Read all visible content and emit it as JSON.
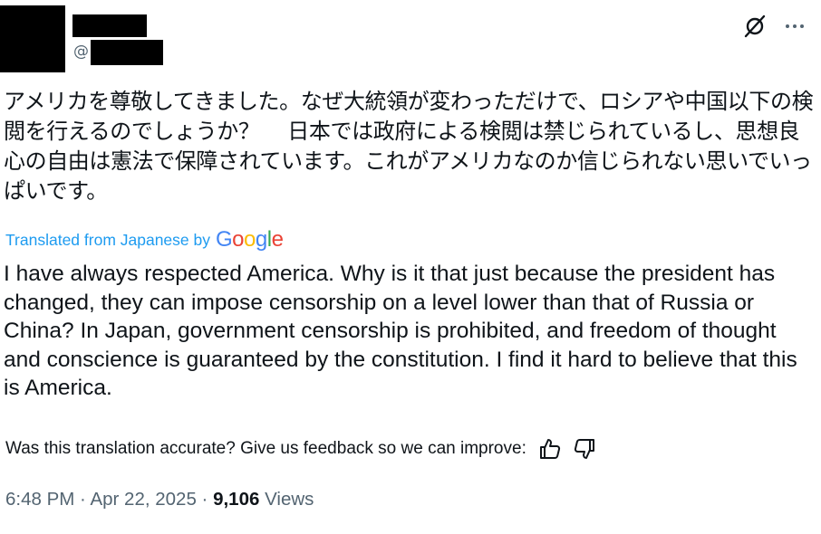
{
  "header": {
    "handle_prefix": "@",
    "icons": {
      "grok": "grok-icon",
      "more": "more-icon"
    }
  },
  "tweet": {
    "original_text": "アメリカを尊敬してきました。なぜ大統領が変わっただけで、ロシアや中国以下の検閲を行えるのでしょうか？　 日本では政府による検閲は禁じられているし、思想良心の自由は憲法で保障されています。これがアメリカなのか信じられない思いでいっぱいです。",
    "translated_label": "Translated from Japanese by",
    "translator_brand": {
      "g1": "G",
      "o1": "o",
      "o2": "o",
      "g2": "g",
      "l": "l",
      "e": "e"
    },
    "translated_text": "I have always respected America. Why is it that just because the president has changed, they can impose censorship on a level lower than that of Russia or China? In Japan, government censorship is prohibited, and freedom of thought and conscience is guaranteed by the constitution. I find it hard to believe that this is America."
  },
  "feedback": {
    "prompt": "Was this translation accurate? Give us feedback so we can improve:",
    "icons": {
      "up": "thumbs-up-icon",
      "down": "thumbs-down-icon"
    }
  },
  "meta": {
    "time": "6:48 PM",
    "sep1": " · ",
    "date": "Apr 22, 2025",
    "sep2": " · ",
    "views_count": "9,106",
    "views_label": " Views"
  },
  "colors": {
    "link": "#1d9bf0",
    "secondary_text": "#536471",
    "google_blue": "#4285F4",
    "google_red": "#EA4335",
    "google_yellow": "#FBBC05",
    "google_green": "#34A853"
  }
}
